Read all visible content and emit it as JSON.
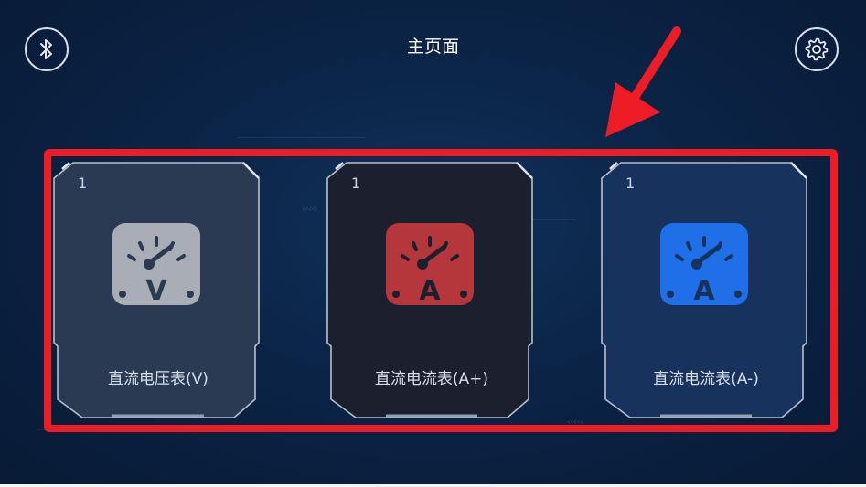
{
  "header": {
    "title": "主页面",
    "bluetooth_icon": "bluetooth-icon",
    "settings_icon": "gear-icon"
  },
  "cards": [
    {
      "count": "1",
      "label": "直流电压表(V)",
      "letter": "V",
      "icon": "voltmeter-gauge-icon",
      "color": "#a8adb6",
      "bg": "#2a3a52"
    },
    {
      "count": "1",
      "label": "直流电流表(A+)",
      "letter": "A",
      "icon": "ammeter-gauge-icon",
      "color": "#b5373b",
      "bg": "#1c1f2e"
    },
    {
      "count": "1",
      "label": "直流电流表(A-)",
      "letter": "A",
      "icon": "ammeter-gauge-icon",
      "color": "#1f6fe8",
      "bg": "#17325c"
    }
  ],
  "annotation": {
    "highlight_color": "#ee1c25"
  }
}
